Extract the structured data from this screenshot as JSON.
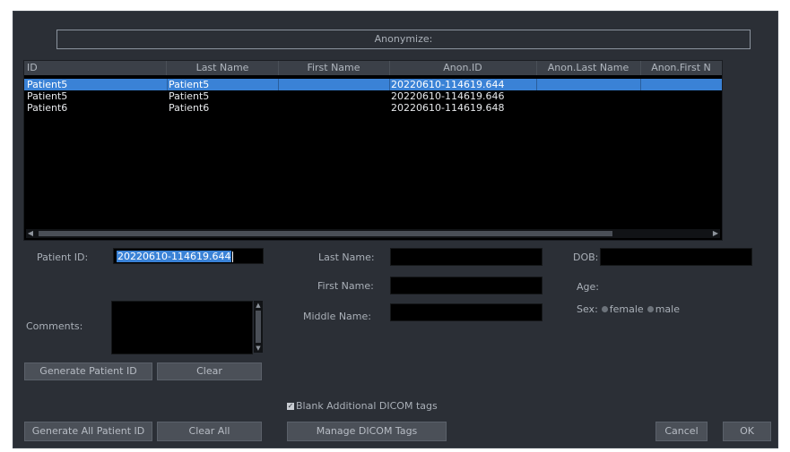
{
  "dialog": {
    "title": "Anonymize:"
  },
  "table": {
    "columns": [
      "ID",
      "Last Name",
      "First Name",
      "Anon.ID",
      "Anon.Last Name",
      "Anon.First N"
    ],
    "rows": [
      {
        "id": "Patient5",
        "last": "Patient5",
        "first": "",
        "anon_id": "20220610-114619.644",
        "anon_last": "",
        "anon_first": "",
        "selected": true
      },
      {
        "id": "Patient5",
        "last": "Patient5",
        "first": "",
        "anon_id": "20220610-114619.646",
        "anon_last": "",
        "anon_first": "",
        "selected": false
      },
      {
        "id": "Patient6",
        "last": "Patient6",
        "first": "",
        "anon_id": "20220610-114619.648",
        "anon_last": "",
        "anon_first": "",
        "selected": false
      }
    ]
  },
  "form": {
    "patient_id_label": "Patient ID:",
    "patient_id_value": "20220610-114619.644",
    "last_name_label": "Last Name:",
    "first_name_label": "First Name:",
    "middle_name_label": "Middle Name:",
    "dob_label": "DOB:",
    "age_label": "Age:",
    "sex_label": "Sex:",
    "sex_female": "female",
    "sex_male": "male",
    "comments_label": "Comments:"
  },
  "buttons": {
    "generate_patient_id": "Generate Patient ID",
    "clear": "Clear",
    "generate_all": "Generate All Patient ID",
    "clear_all": "Clear All",
    "manage_dicom": "Manage DICOM Tags",
    "cancel": "Cancel",
    "ok": "OK"
  },
  "options": {
    "blank_dicom_label": "Blank Additional DICOM tags",
    "blank_dicom_checked": true
  },
  "colors": {
    "background": "#2b2f36",
    "selection": "#3a82d6",
    "button": "#4b5058"
  }
}
